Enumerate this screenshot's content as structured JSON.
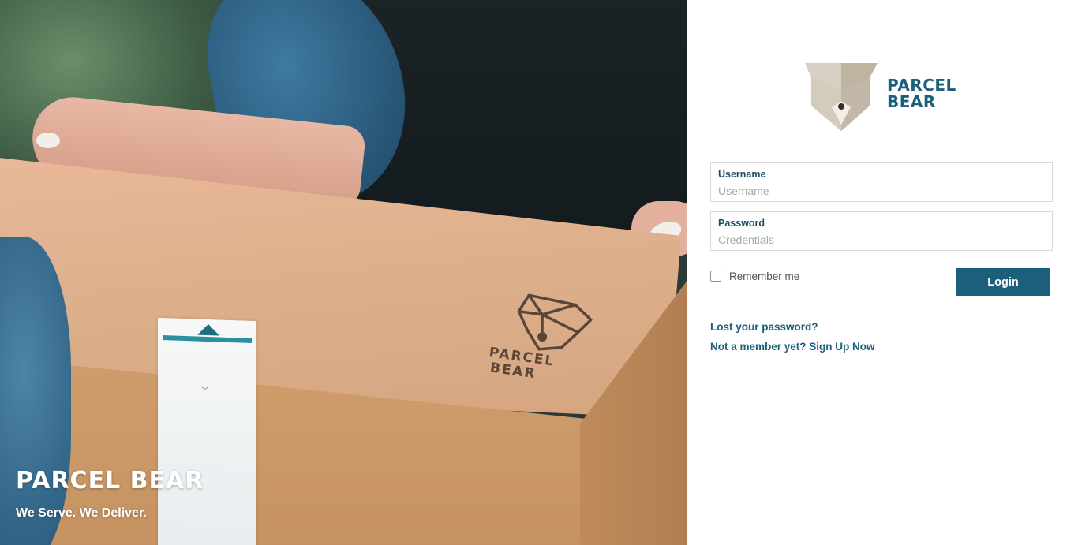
{
  "hero": {
    "title": "PARCEL BEAR",
    "tagline": "We Serve. We Deliver.",
    "box_logo_line1": "PARCEL",
    "box_logo_line2": "BEAR"
  },
  "brand": {
    "name_line1": "PARCEL",
    "name_line2": "BEAR",
    "icon": "bear-box-logo-icon",
    "color": "#1c5f7c"
  },
  "form": {
    "username": {
      "label": "Username",
      "placeholder": "Username",
      "value": ""
    },
    "password": {
      "label": "Password",
      "placeholder": "Credentials",
      "value": ""
    },
    "remember_label": "Remember me",
    "remember_checked": false,
    "login_label": "Login"
  },
  "links": {
    "lost_password": "Lost your password?",
    "sign_up": "Not a member yet? Sign Up Now"
  },
  "colors": {
    "accent": "#1c5f7c",
    "label": "#1e4d63",
    "field_border": "#d7dbdd"
  }
}
